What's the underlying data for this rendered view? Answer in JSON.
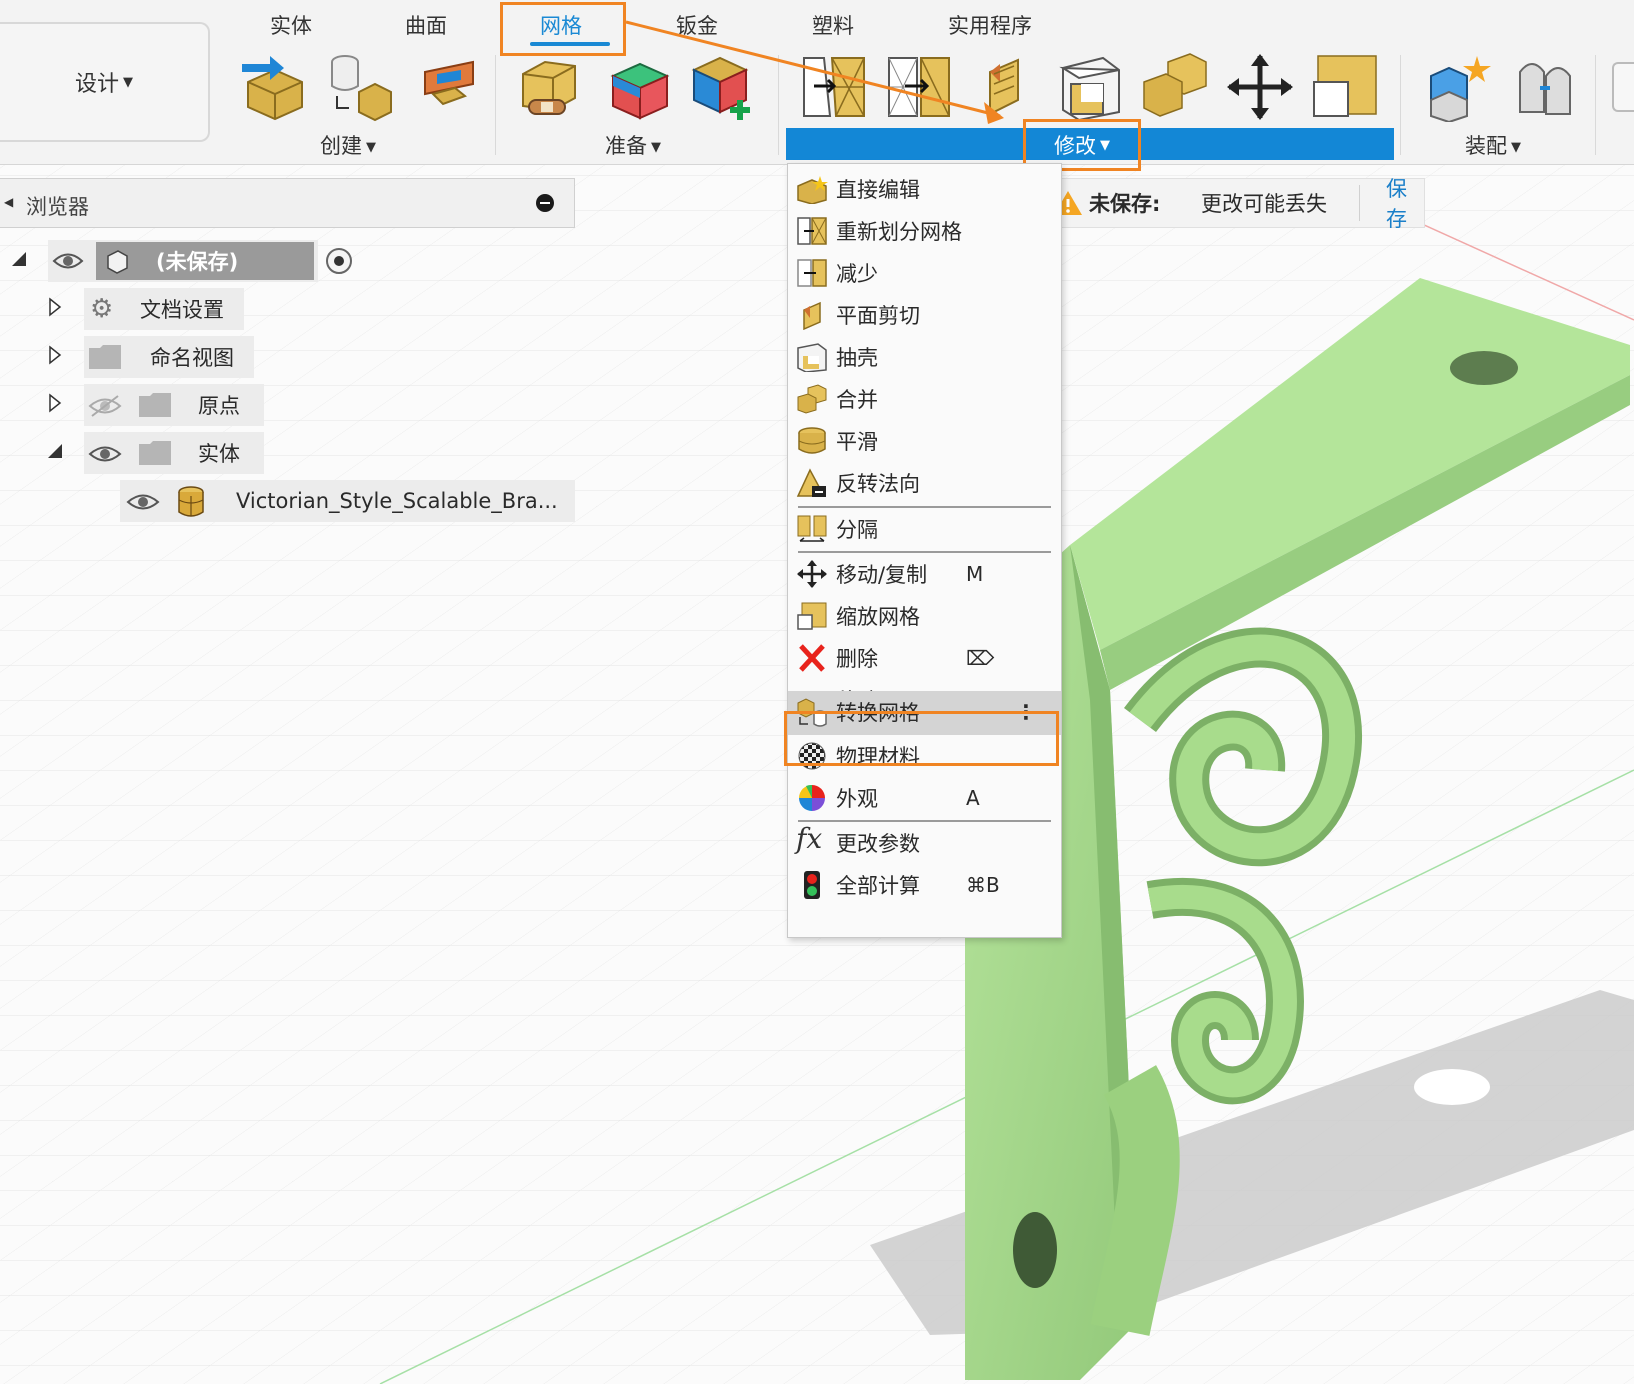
{
  "toolbar": {
    "design_label": "设计",
    "tabs": [
      "实体",
      "曲面",
      "网格",
      "钣金",
      "塑料",
      "实用程序"
    ],
    "active_tab": "网格",
    "groups": {
      "create": "创建",
      "prepare": "准备",
      "modify": "修改",
      "assemble": "装配"
    }
  },
  "browser": {
    "title": "浏览器",
    "root_label": "(未保存)",
    "items": [
      "文档设置",
      "命名视图",
      "原点",
      "实体"
    ],
    "body_name": "Victorian_Style_Scalable_Bra..."
  },
  "notice": {
    "label": "未保存:",
    "message": "更改可能丢失",
    "save": "保存"
  },
  "menu": {
    "items": [
      {
        "label": "直接编辑",
        "icon": "direct-edit-icon",
        "shortcut": ""
      },
      {
        "label": "重新划分网格",
        "icon": "remesh-icon",
        "shortcut": ""
      },
      {
        "label": "减少",
        "icon": "reduce-icon",
        "shortcut": ""
      },
      {
        "label": "平面剪切",
        "icon": "plane-cut-icon",
        "shortcut": ""
      },
      {
        "label": "抽壳",
        "icon": "shell-icon",
        "shortcut": ""
      },
      {
        "label": "合并",
        "icon": "combine-icon",
        "shortcut": ""
      },
      {
        "label": "平滑",
        "icon": "smooth-icon",
        "shortcut": ""
      },
      {
        "label": "反转法向",
        "icon": "reverse-normal-icon",
        "shortcut": ""
      },
      {
        "label": "分隔",
        "icon": "separate-icon",
        "shortcut": ""
      },
      {
        "label": "移动/复制",
        "icon": "move-copy-icon",
        "shortcut": "M"
      },
      {
        "label": "缩放网格",
        "icon": "scale-mesh-icon",
        "shortcut": ""
      },
      {
        "label": "删除",
        "icon": "delete-icon",
        "shortcut": "⌦"
      },
      {
        "label": "移除",
        "icon": "remove-icon",
        "shortcut": ""
      },
      {
        "label": "转换网格",
        "icon": "convert-mesh-icon",
        "shortcut": "⋮"
      },
      {
        "label": "物理材料",
        "icon": "physical-material-icon",
        "shortcut": ""
      },
      {
        "label": "外观",
        "icon": "appearance-icon",
        "shortcut": "A"
      },
      {
        "label": "更改参数",
        "icon": "change-parameters-icon",
        "shortcut": ""
      },
      {
        "label": "全部计算",
        "icon": "compute-all-icon",
        "shortcut": "⌘B"
      }
    ],
    "highlighted": "转换网格"
  },
  "colors": {
    "accent_blue": "#1387d6",
    "annotation_orange": "#f08422",
    "model_green": "#a8dc8c"
  }
}
